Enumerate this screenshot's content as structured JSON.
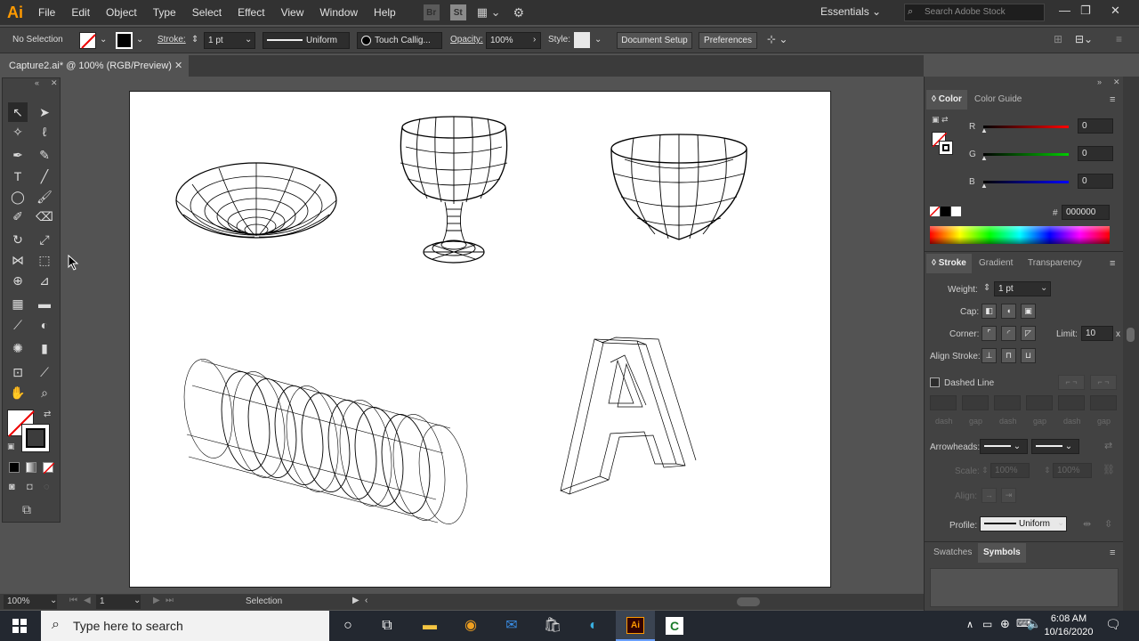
{
  "app": {
    "logo": "Ai",
    "menu": [
      "File",
      "Edit",
      "Object",
      "Type",
      "Select",
      "Effect",
      "View",
      "Window",
      "Help"
    ],
    "bridge_icon": "Br",
    "stock_icon": "St",
    "workspace": "Essentials",
    "search_placeholder": "Search Adobe Stock"
  },
  "control_bar": {
    "selection": "No Selection",
    "stroke_label": "Stroke:",
    "stroke_weight": "1 pt",
    "profile": "Uniform",
    "brush": "Touch Callig...",
    "opacity_label": "Opacity:",
    "opacity": "100%",
    "style_label": "Style:",
    "doc_setup": "Document Setup",
    "preferences": "Preferences"
  },
  "document": {
    "tab_title": "Capture2.ai* @ 100% (RGB/Preview)",
    "close": "✕"
  },
  "status": {
    "zoom": "100%",
    "artboard": "1",
    "mode": "Selection"
  },
  "color_panel": {
    "tab_color": "Color",
    "tab_guide": "Color Guide",
    "r_label": "R",
    "r": "0",
    "g_label": "G",
    "g": "0",
    "b_label": "B",
    "b": "0",
    "hex_label": "#",
    "hex": "000000"
  },
  "stroke_panel": {
    "tab_stroke": "Stroke",
    "tab_gradient": "Gradient",
    "tab_transparency": "Transparency",
    "weight_label": "Weight:",
    "weight": "1 pt",
    "cap_label": "Cap:",
    "corner_label": "Corner:",
    "limit_label": "Limit:",
    "limit": "10",
    "limit_unit": "x",
    "align_label": "Align Stroke:",
    "dashed_label": "Dashed Line",
    "dash_labels": [
      "dash",
      "gap",
      "dash",
      "gap",
      "dash",
      "gap"
    ],
    "arrowheads_label": "Arrowheads:",
    "scale_label": "Scale:",
    "scale_1": "100%",
    "scale_2": "100%",
    "align_arrow_label": "Align:",
    "profile_label": "Profile:",
    "profile": "Uniform"
  },
  "bottom_tabs": {
    "swatches": "Swatches",
    "symbols": "Symbols"
  },
  "taskbar": {
    "search": "Type here to search",
    "time": "6:08 AM",
    "date": "10/16/2020"
  },
  "colors": {
    "accent_orange": "#ff9a00",
    "panel_bg": "#424242",
    "canvas_bg": "#535353"
  }
}
